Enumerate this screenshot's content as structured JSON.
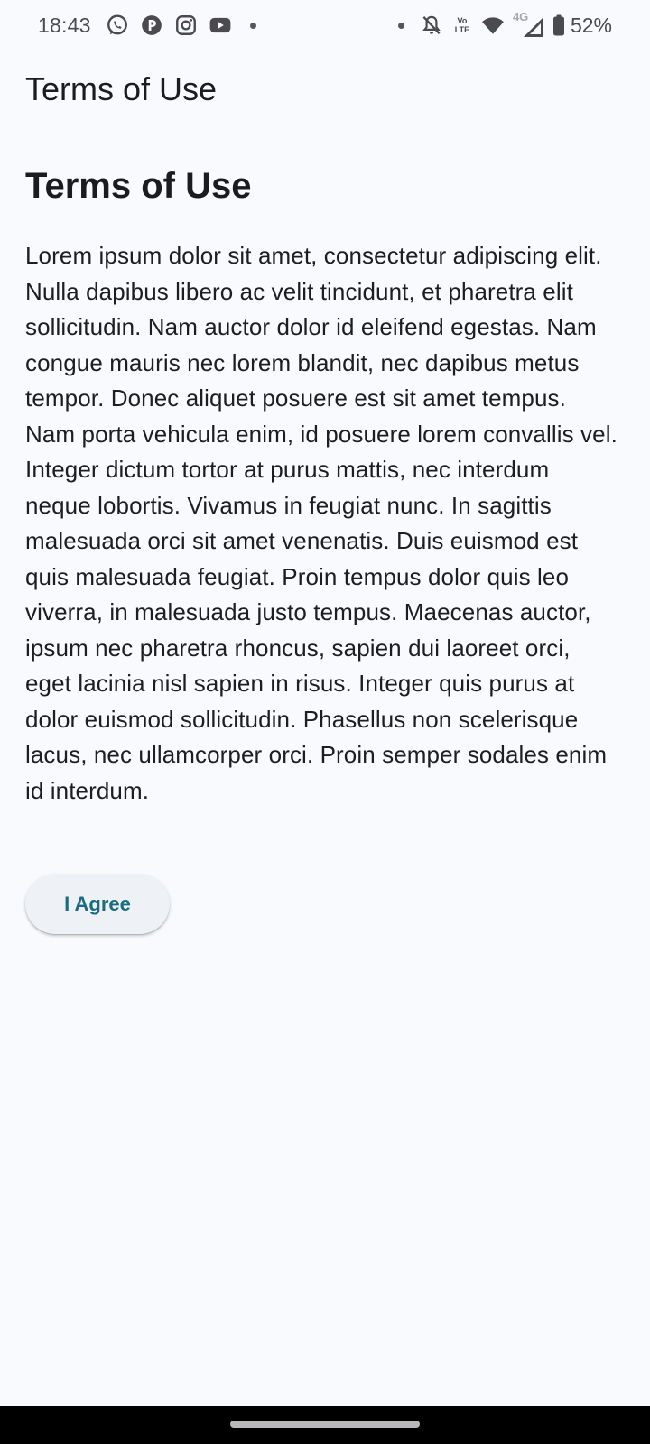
{
  "status_bar": {
    "time": "18:43",
    "left_icons": [
      "whatsapp-icon",
      "app-icon",
      "instagram-icon",
      "youtube-icon"
    ],
    "right_icons": [
      "notifications-off-icon",
      "volte-icon",
      "wifi-icon",
      "signal-icon",
      "battery-icon"
    ],
    "volte_top": "Vo",
    "volte_bottom": "LTE",
    "network_type": "4G",
    "battery_percent": "52%"
  },
  "app_bar": {
    "title": "Terms of Use"
  },
  "content": {
    "heading": "Terms of Use",
    "body": "Lorem ipsum dolor sit amet, consectetur adipiscing elit. Nulla dapibus libero ac velit tincidunt, et pharetra elit sollicitudin. Nam auctor dolor id eleifend egestas. Nam congue mauris nec lorem blandit, nec dapibus metus tempor. Donec aliquet posuere est sit amet tempus. Nam porta vehicula enim, id posuere lorem convallis vel. Integer dictum tortor at purus mattis, nec interdum neque lobortis. Vivamus in feugiat nunc. In sagittis malesuada orci sit amet venenatis. Duis euismod est quis malesuada feugiat. Proin tempus dolor quis leo viverra, in malesuada justo tempus. Maecenas auctor, ipsum nec pharetra rhoncus, sapien dui laoreet orci, eget lacinia nisl sapien in risus. Integer quis purus at dolor euismod sollicitudin. Phasellus non scelerisque lacus, nec ullamcorper orci. Proin semper sodales enim id interdum.",
    "agree_button_label": "I Agree"
  },
  "colors": {
    "background": "#f9fafd",
    "button_background": "#eef2f7",
    "button_text": "#1b6c82",
    "nav_bar": "#000000"
  }
}
